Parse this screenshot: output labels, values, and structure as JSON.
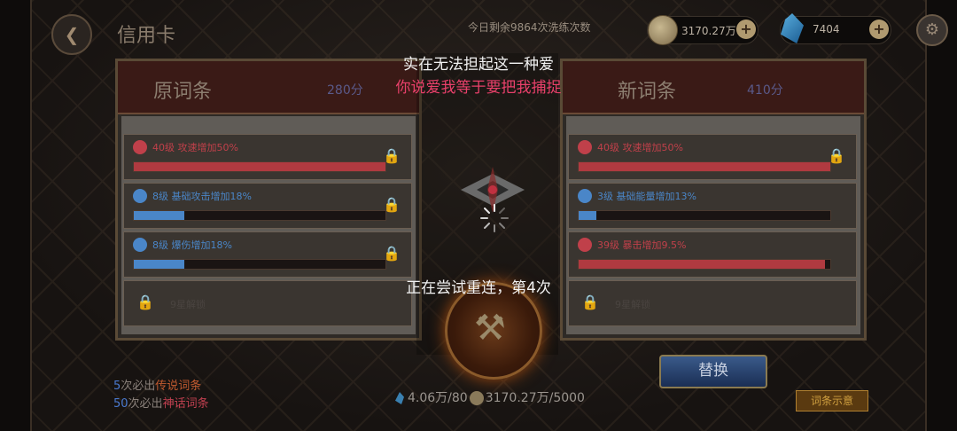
{
  "header": {
    "title": "信用卡",
    "remaining": "今日剩余9864次洗练次数",
    "coins": "3170.27万",
    "gems": "7404"
  },
  "left_panel": {
    "title": "原词条",
    "score": "280分",
    "rows": [
      {
        "text": "40级 攻速增加50%",
        "color": "#c0404a",
        "fill": 1.0
      },
      {
        "text": "8级 基础攻击增加18%",
        "color": "#4a86c8",
        "fill": 0.2
      },
      {
        "text": "8级 爆伤增加18%",
        "color": "#4a86c8",
        "fill": 0.2
      }
    ],
    "locked_text": "9星解锁"
  },
  "right_panel": {
    "title": "新词条",
    "score": "410分",
    "rows": [
      {
        "text": "40级 攻速增加50%",
        "color": "#c0404a",
        "fill": 1.0
      },
      {
        "text": "3级 基础能量增加13%",
        "color": "#4a86c8",
        "fill": 0.07
      },
      {
        "text": "39级 暴击增加9.5%",
        "color": "#c0404a",
        "fill": 0.98
      }
    ],
    "locked_text": "9星解锁"
  },
  "overlay": {
    "line1": "实在无法担起这一种爱",
    "line2": "你说爱我等于要把我捕捉",
    "reconnect": "正在尝试重连，第4次"
  },
  "buttons": {
    "replace": "替换",
    "example": "词条示意"
  },
  "guarantee": {
    "legend_num": "5",
    "legend_text": "次必出",
    "legend_tag": "传说词条",
    "myth_num": "50",
    "myth_text": "次必出",
    "myth_tag": "神话词条"
  },
  "cost": {
    "gems": "4.06万/80",
    "coins": "3170.27万/5000"
  }
}
